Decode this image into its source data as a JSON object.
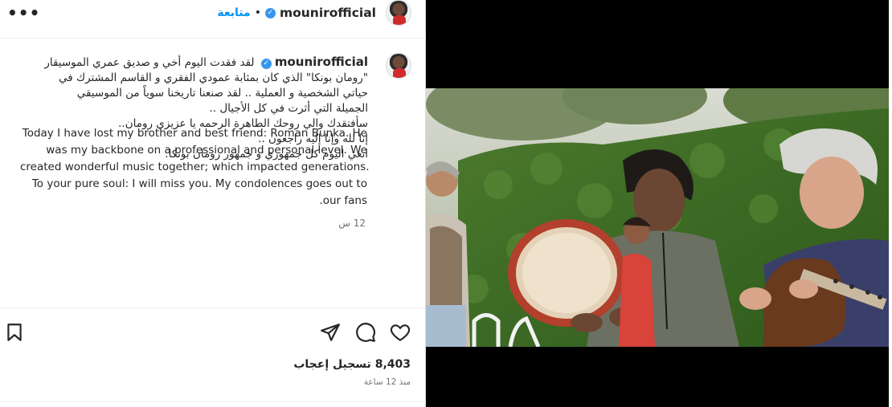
{
  "header": {
    "username": "mounirofficial",
    "separator": "•",
    "follow_label": "متابعة",
    "more_label": "•••",
    "verified_mark": "✓"
  },
  "caption": {
    "username": "mounirofficial",
    "arabic_lines": [
      "لقد فقدت اليوم أخي و صديق عمري الموسيقار",
      "\"رومان بونكا\" الذي كان بمثابة عمودي الفقري و القاسم المشترك في",
      "حياتي الشخصية و العملية .. لقد صنعنا تاريخنا سوياً من الموسيقي",
      "الجميلة التي أثرت في كل الأجيال ..",
      "سأفتقدك والي روحك الطاهرة الرحمه يا عزيزي رومان..",
      "إنا لله وإنا إليه راجعون ..",
      "انعي اليوم كل جمهوري و جمهور رومان بونكا."
    ],
    "english_lines": [
      "Today I have lost my brother and best friend: Roman Bunka. He",
      "was my backbone on a professional and personal level. We",
      "created wonderful music together; which impacted generations.",
      "To your pure soul: I will miss you. My condolences goes out to",
      ".our fans"
    ],
    "time": "12 س"
  },
  "actions": {
    "icons": [
      "heart-icon",
      "comment-icon",
      "share-icon",
      "bookmark-icon"
    ]
  },
  "stats": {
    "likes_label": "8,403 تسجيل إعجاب",
    "posted_ago": "منذ 12 ساعة"
  },
  "colors": {
    "link_blue": "#0095f6",
    "verified_blue": "#3797f0",
    "text": "#262626",
    "muted": "#737373"
  }
}
